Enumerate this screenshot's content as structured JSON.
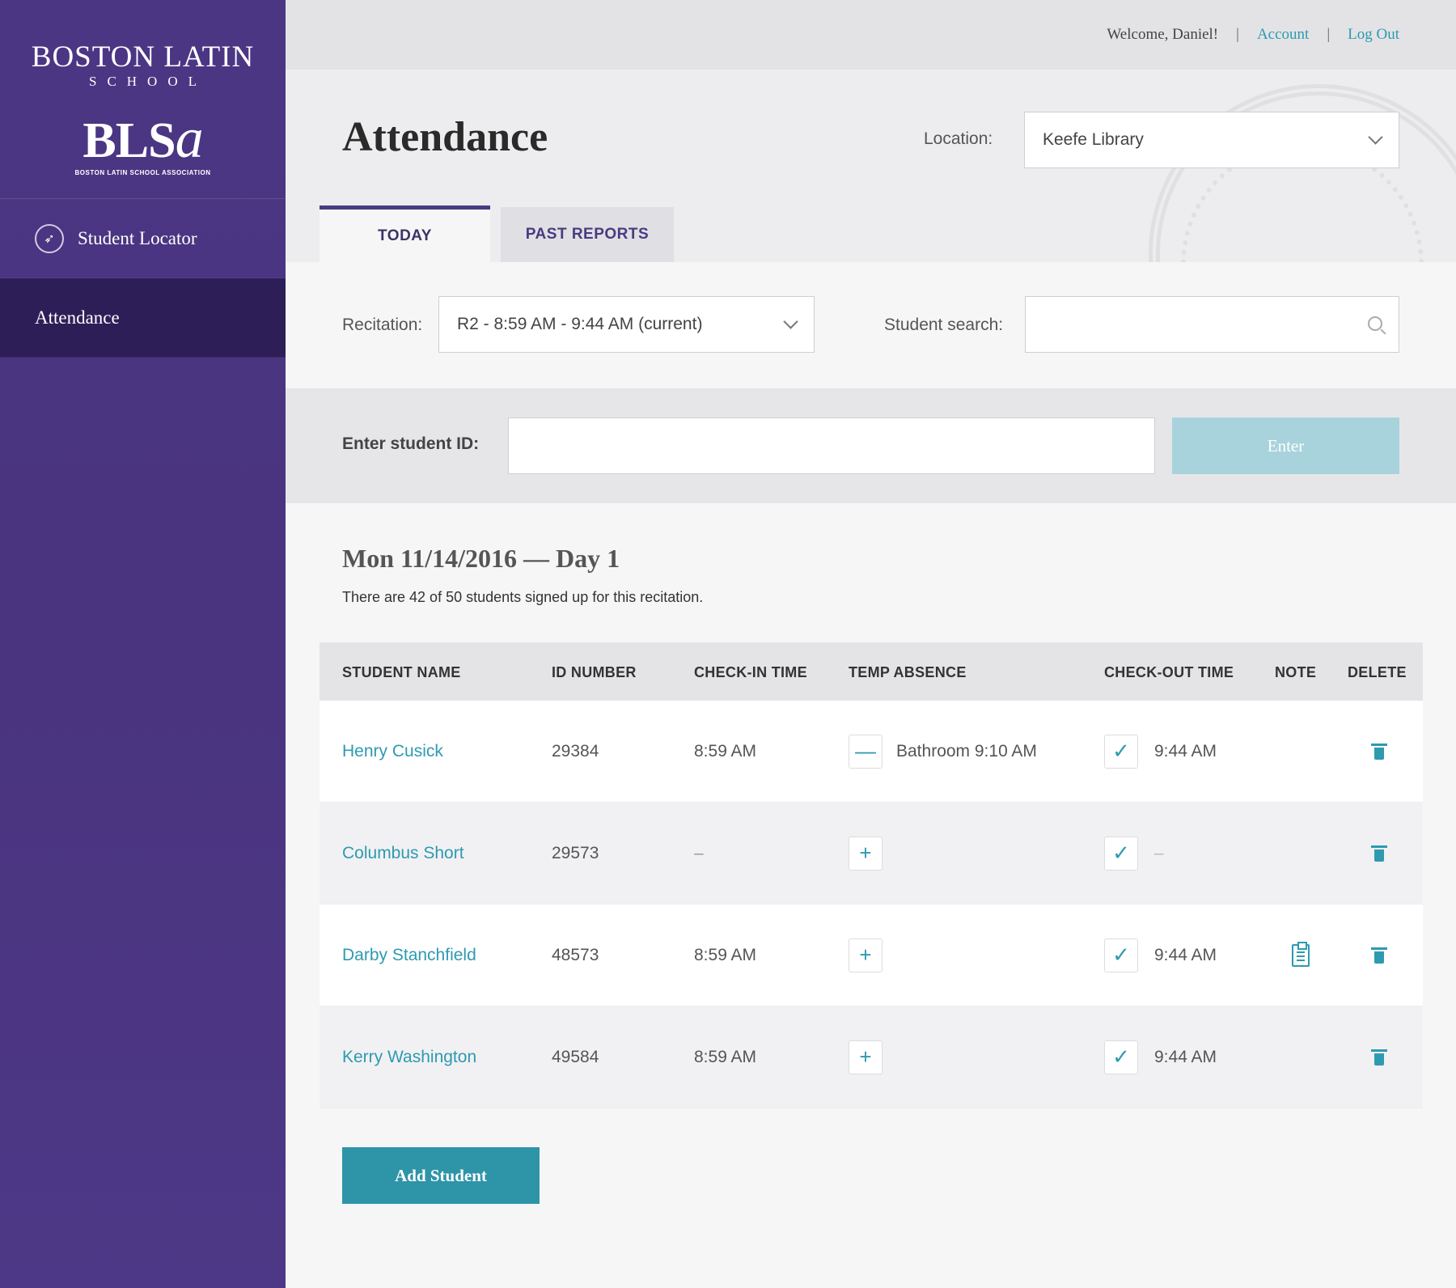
{
  "sidebar": {
    "brand": {
      "line1": "BOSTON LATIN",
      "line2": "SCHOOL",
      "logo_main": "BLS",
      "logo_accent": "a",
      "logo_subtitle": "BOSTON LATIN SCHOOL ASSOCIATION"
    },
    "items": [
      {
        "label": "Student Locator",
        "icon": "compass-icon"
      },
      {
        "label": "Attendance",
        "active": true
      }
    ]
  },
  "topbar": {
    "welcome": "Welcome, Daniel!",
    "separator": "|",
    "account": "Account",
    "logout": "Log Out"
  },
  "header": {
    "title": "Attendance",
    "location_label": "Location:",
    "location_value": "Keefe Library",
    "tabs": [
      {
        "label": "TODAY",
        "active": true
      },
      {
        "label": "PAST REPORTS",
        "active": false
      }
    ]
  },
  "filters": {
    "recitation_label": "Recitation:",
    "recitation_value": "R2 - 8:59 AM - 9:44 AM (current)",
    "search_label": "Student search:",
    "search_value": ""
  },
  "entry": {
    "label": "Enter student ID:",
    "value": "",
    "button": "Enter"
  },
  "content": {
    "date_title": "Mon 11/14/2016 — Day 1",
    "summary": "There are 42 of 50 students signed up for this recitation."
  },
  "table": {
    "headers": {
      "name": "STUDENT NAME",
      "id": "ID NUMBER",
      "checkin": "CHECK-IN TIME",
      "temp": "TEMP ABSENCE",
      "checkout": "CHECK-OUT TIME",
      "note": "NOTE",
      "delete": "DELETE"
    },
    "rows": [
      {
        "name": "Henry Cusick",
        "id": "29384",
        "checkin": "8:59 AM",
        "temp_symbol": "—",
        "temp_text": "Bathroom 9:10 AM",
        "check_symbol": "✓",
        "checkout": "9:44 AM"
      },
      {
        "name": "Columbus Short",
        "id": "29573",
        "checkin": "–",
        "temp_symbol": "+",
        "temp_text": "",
        "check_symbol": "✓",
        "checkout": "–"
      },
      {
        "name": "Darby Stanchfield",
        "id": "48573",
        "checkin": "8:59 AM",
        "temp_symbol": "+",
        "temp_text": "",
        "check_symbol": "✓",
        "checkout": "9:44 AM",
        "has_note": true
      },
      {
        "name": "Kerry Washington",
        "id": "49584",
        "checkin": "8:59 AM",
        "temp_symbol": "+",
        "temp_text": "",
        "check_symbol": "✓",
        "checkout": "9:44 AM"
      }
    ]
  },
  "actions": {
    "add_student": "Add Student"
  },
  "colors": {
    "sidebar": "#4b3684",
    "sidebar_active": "#2e1e58",
    "accent": "#2e9ab0",
    "enter_button": "#a8d3dc",
    "add_button": "#2e94a8"
  }
}
